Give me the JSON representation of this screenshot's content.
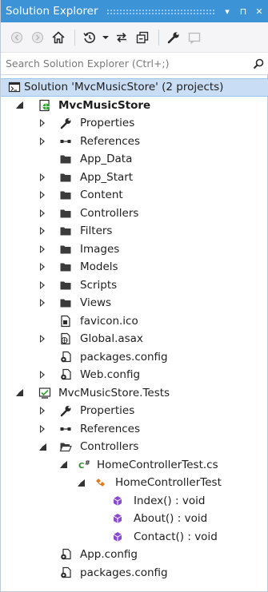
{
  "window": {
    "title": "Solution Explorer",
    "pin_glyph": "▾",
    "auto_hide_glyph": "⊓",
    "close_glyph": "✕"
  },
  "search": {
    "placeholder": "Search Solution Explorer (Ctrl+;)"
  },
  "colors": {
    "titlebar": "#3c94d6",
    "selection": "#c9def5",
    "folder": "#3b3b3b",
    "method": "#8a4bd1",
    "class": "#e07a1f",
    "csharp": "#2e8b2e"
  },
  "toolbar": {
    "buttons": [
      "back-icon",
      "forward-icon",
      "home-icon",
      "history-icon",
      "dropdown-icon",
      "sync-icon",
      "collapse-all-icon",
      "properties-icon",
      "preview-icon"
    ]
  },
  "tree": {
    "solution": "Solution 'MvcMusicStore' (2 projects)",
    "project1": {
      "name": "MvcMusicStore",
      "items": {
        "properties": "Properties",
        "references": "References",
        "app_data": "App_Data",
        "app_start": "App_Start",
        "content": "Content",
        "controllers": "Controllers",
        "filters": "Filters",
        "images": "Images",
        "models": "Models",
        "scripts": "Scripts",
        "views": "Views",
        "favicon": "favicon.ico",
        "global": "Global.asax",
        "packages": "packages.config",
        "webconfig": "Web.config"
      }
    },
    "project2": {
      "name": "MvcMusicStore.Tests",
      "items": {
        "properties": "Properties",
        "references": "References",
        "controllers": "Controllers",
        "test_file": "HomeControllerTest.cs",
        "test_class": "HomeControllerTest",
        "method_index": "Index() : void",
        "method_about": "About() : void",
        "method_contact": "Contact() : void",
        "appconfig": "App.config",
        "packages": "packages.config"
      }
    }
  }
}
